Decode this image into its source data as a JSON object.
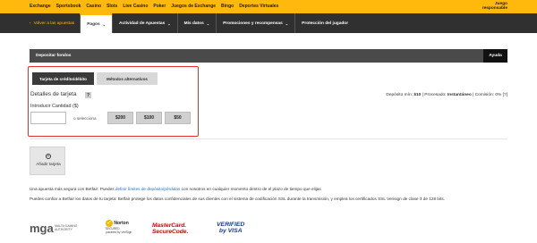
{
  "top_nav": {
    "items": [
      "Exchange",
      "Sportsbook",
      "Casino",
      "Slots",
      "Live Casino",
      "Poker",
      "Juegos de Exchange",
      "Bingo",
      "Deportes Virtuales"
    ],
    "responsible_gaming": "Juego responsable"
  },
  "sub_nav": {
    "back_link": "Volver a las apuestas",
    "tabs": [
      {
        "label": "Pagos",
        "active": true,
        "has_caret": true
      },
      {
        "label": "Actividad de Apuestas",
        "active": false,
        "has_caret": true
      },
      {
        "label": "Mis datos",
        "active": false,
        "has_caret": true
      },
      {
        "label": "Promociones y recompensas",
        "active": false,
        "has_caret": true
      },
      {
        "label": "Protección del jugador",
        "active": false,
        "has_caret": false
      }
    ]
  },
  "panel": {
    "title": "Depositar fondos",
    "help": "Ayuda"
  },
  "method_tabs": {
    "card": "Tarjeta de crédito/débito",
    "alternative": "Métodos alternativos"
  },
  "details": {
    "title": "Detalles de tarjeta",
    "help_icon": "?",
    "amount_label": "Introducir Cantidad ($)",
    "amount_value": "",
    "or_select": "o selecciona",
    "amount_buttons": [
      "$200",
      "$100",
      "$50"
    ]
  },
  "limits": {
    "min_label": "Depósito mín:",
    "min_value": "$10",
    "processing_label": "Procesado:",
    "processing_value": "Instantáneo",
    "commission_label": "Comisión:",
    "commission_value": "0%",
    "commission_link": "[?]"
  },
  "add_card": {
    "icon": "+",
    "label": "Añadir tarjeta"
  },
  "notes": {
    "line1_pre": "Una apuesta más segura con Betfair: Puedes",
    "line1_link": "definir límites de depósito/pérdidas",
    "line1_post": "con nosotros en cualquier momento dentro de el plazo de tiempo que elijas",
    "line2": "Puedes confiar a Betfair los datos de tu tarjeta: Betfair protege los datos confidenciales de sus clientes con el sistema de codificación SSL durante la transmisión, y emplea los certificados SSL Verisign de clase 3 de 128 bits."
  },
  "logos": {
    "mga_mark": "mga",
    "mga_text": "MALTA GAMING AUTHORITY",
    "norton_title": "Norton",
    "norton_sub1": "SECURED",
    "norton_sub2": "powered by VeriSign",
    "mastercard_line1": "MasterCard.",
    "mastercard_line2": "SecureCode.",
    "visa_line1": "VERIFIED",
    "visa_line2": "by VISA"
  },
  "colors": {
    "brand_yellow": "#ffb80c",
    "nav_dark": "#303030",
    "highlight_red": "#e03030",
    "link_blue": "#2a6db0"
  }
}
